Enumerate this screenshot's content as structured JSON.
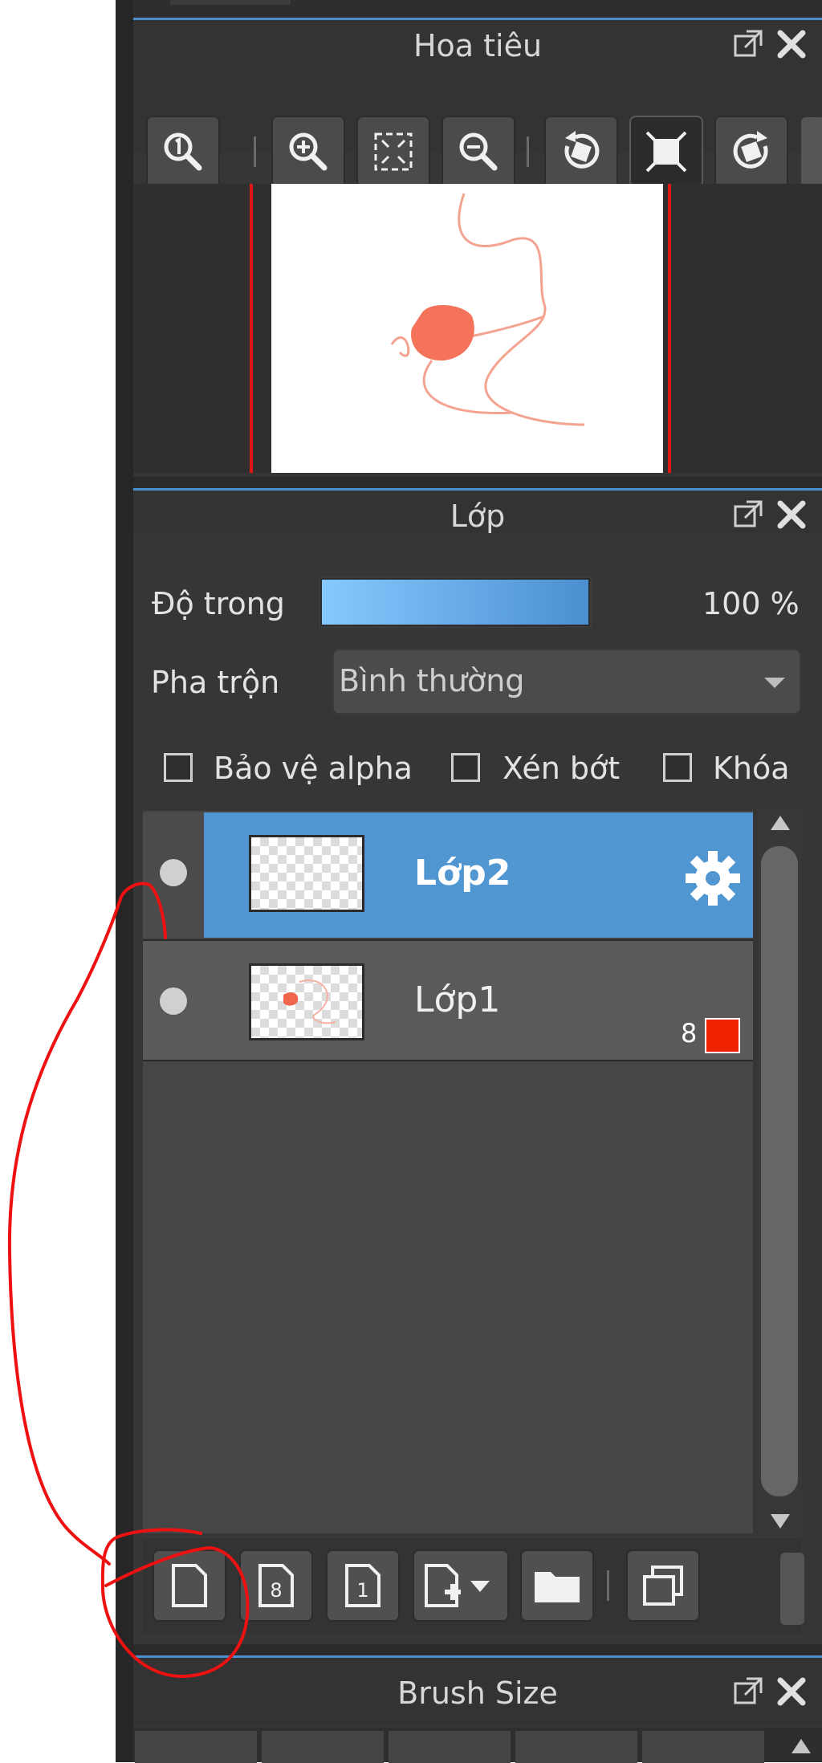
{
  "navigator": {
    "title": "Hoa tiêu",
    "tools": [
      {
        "name": "zoom-actual-icon"
      },
      {
        "name": "zoom-in-icon"
      },
      {
        "name": "fit-screen-icon"
      },
      {
        "name": "zoom-out-icon"
      },
      {
        "name": "rotate-left-icon"
      },
      {
        "name": "fit-canvas-icon",
        "active": true
      },
      {
        "name": "rotate-right-icon"
      }
    ]
  },
  "layers": {
    "title": "Lớp",
    "opacity_label": "Độ trong",
    "opacity_value": "100 %",
    "opacity_fraction": 1.0,
    "blend_label": "Pha trộn",
    "blend_value": "Bình thường",
    "checkboxes": [
      {
        "label": "Bảo vệ alpha",
        "checked": false
      },
      {
        "label": "Xén bớt",
        "checked": false
      },
      {
        "label": "Khóa",
        "checked": false
      }
    ],
    "items": [
      {
        "name": "Lớp2",
        "selected": true,
        "settings_icon": "gear-icon"
      },
      {
        "name": "Lớp1",
        "selected": false,
        "badge": "8",
        "badge_color": "#ee2200"
      }
    ],
    "bottom_tools": [
      "add-layer-icon",
      "add-8bit-layer-icon",
      "add-1bit-layer-icon",
      "add-layer-menu-icon",
      "add-folder-icon",
      "duplicate-layer-icon"
    ]
  },
  "brush_size": {
    "title": "Brush Size"
  },
  "colors": {
    "accent": "#4a8fd0",
    "selected_row": "#5096d0",
    "annotation_red": "#ee1111"
  }
}
